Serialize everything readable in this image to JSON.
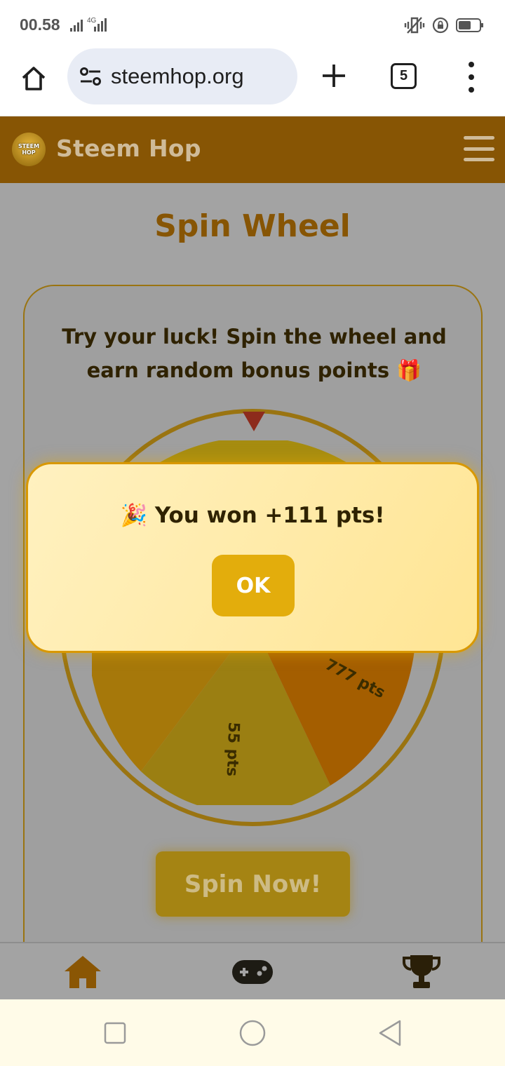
{
  "status_bar": {
    "time": "00.58",
    "network": "4G"
  },
  "browser": {
    "url": "steemhop.org",
    "tab_count": "5"
  },
  "header": {
    "site_name": "Steem Hop",
    "logo_text_1": "STEEM",
    "logo_text_2": "HOP"
  },
  "main": {
    "title": "Spin Wheel",
    "description": "Try your luck! Spin the wheel and earn random bonus points 🎁",
    "spin_button": "Spin Now!",
    "wheel_segments": [
      {
        "label": "55 pts",
        "color": "#9b7f12"
      },
      {
        "label": "777 pts",
        "color": "#a45e00"
      }
    ]
  },
  "modal": {
    "message": "🎉 You won +111 pts!",
    "ok_label": "OK"
  },
  "bottom_nav": {
    "items": [
      "home-icon",
      "gamepad-icon",
      "trophy-icon"
    ]
  },
  "colors": {
    "header": "#875504",
    "accent": "#e3ad0c",
    "modal_bg": "#fff1c0"
  }
}
